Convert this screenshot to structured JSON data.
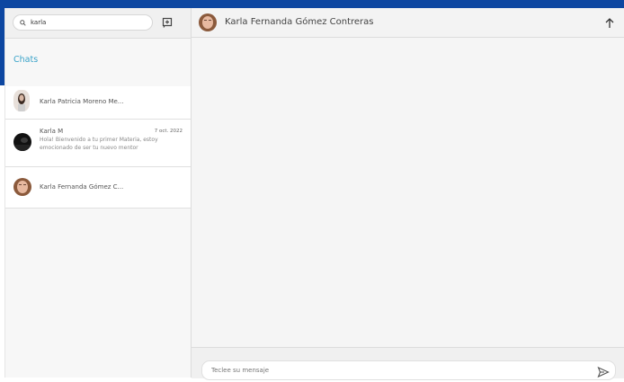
{
  "sidebar": {
    "search": {
      "value": "karla",
      "icon": "search-icon"
    },
    "new_chat_icon": "new-chat-icon",
    "section_title": "Chats",
    "chats": [
      {
        "name": "Karla Patricia Moreno Me...",
        "date": "",
        "preview": ""
      },
      {
        "name": "Karla M",
        "date": "7 oct. 2022",
        "preview": "Hola! Bienvenido a tu primer Materia, estoy emocionado de ser tu nuevo mentor"
      },
      {
        "name": "Karla Fernanda Gómez C...",
        "date": "",
        "preview": ""
      }
    ]
  },
  "conversation": {
    "contact_name": "Karla Fernanda Gómez Contreras",
    "header_icon": "arrow-up-icon",
    "composer_placeholder": "Teclee su mensaje",
    "send_icon": "send-icon"
  },
  "colors": {
    "brand_blue": "#0d47a1",
    "accent": "#3aa3c9"
  }
}
